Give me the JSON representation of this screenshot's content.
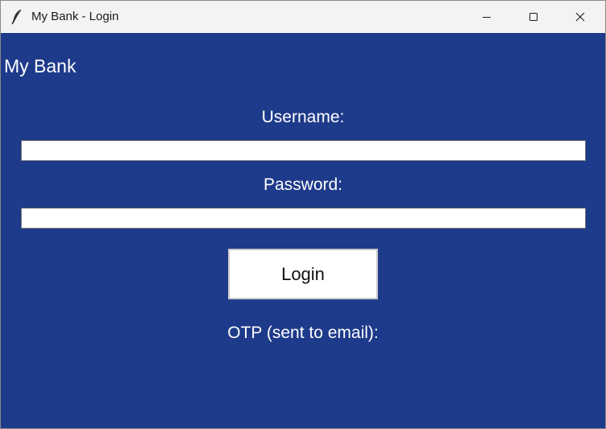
{
  "window": {
    "title": "My Bank - Login",
    "app_icon": "feather-icon",
    "controls": {
      "minimize_icon": "minimize-icon",
      "maximize_icon": "maximize-icon",
      "close_icon": "close-icon"
    }
  },
  "app": {
    "title": "My Bank",
    "background_color": "#1e3a8a"
  },
  "form": {
    "username_label": "Username:",
    "username_value": "",
    "password_label": "Password:",
    "password_value": "",
    "login_label": "Login",
    "otp_label": "OTP (sent to email):"
  }
}
